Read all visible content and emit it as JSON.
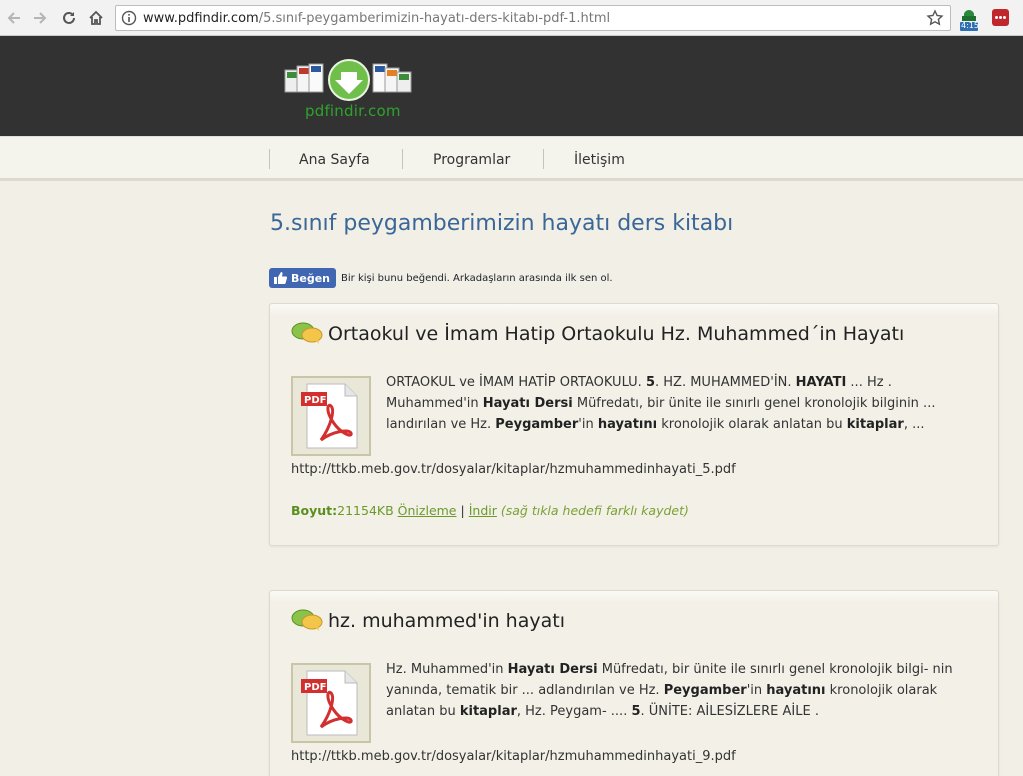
{
  "browser": {
    "url_host": "www.pdfindir.com",
    "url_path": "/5.sınıf-peygamberimizin-hayatı-ders-kitabı-pdf-1.html",
    "ext_badge": "4:15"
  },
  "site": {
    "logo_text": "pdfindir.com"
  },
  "nav": {
    "items": [
      "Ana Sayfa",
      "Programlar",
      "İletişim"
    ]
  },
  "page": {
    "title": "5.sınıf peygamberimizin hayatı ders kitabı"
  },
  "facebook": {
    "button": "Beğen",
    "text": "Bir kişi bunu beğendi. Arkadaşların arasında ilk sen ol."
  },
  "results": [
    {
      "title": "Ortaokul ve İmam Hatip Ortaokulu Hz. Muhammed´in Hayatı",
      "url": "http://ttkb.meb.gov.tr/dosyalar/kitaplar/hzmuhammedinhayati_5.pdf",
      "size_label": "Boyut:",
      "size_value": "21154KB",
      "preview_label": "Önizleme",
      "separator": "|",
      "download_label": "İndir",
      "hint": "(sağ tıkla hedefi farklı kaydet)"
    },
    {
      "title": "hz. muhammed'in hayatı",
      "url": "http://ttkb.meb.gov.tr/dosyalar/kitaplar/hzmuhammedinhayati_9.pdf"
    }
  ],
  "snippets": {
    "r0": [
      {
        "t": "ORTAOKUL ve İMAM HATİP ORTAOKULU. "
      },
      {
        "t": "5",
        "b": true
      },
      {
        "t": ". HZ. MUHAMMED'İN. "
      },
      {
        "t": "HAYATI",
        "b": true
      },
      {
        "t": " ... Hz . Muhammed'in "
      },
      {
        "t": "Hayatı Dersi",
        "b": true
      },
      {
        "t": " Müfredatı, bir ünite ile sınırlı genel kronolojik bilginin ... landırılan ve Hz. "
      },
      {
        "t": "Peygamber",
        "b": true
      },
      {
        "t": "'in "
      },
      {
        "t": "hayatını",
        "b": true
      },
      {
        "t": " kronolojik olarak anlatan bu "
      },
      {
        "t": "kitaplar",
        "b": true
      },
      {
        "t": ", ..."
      }
    ],
    "r1": [
      {
        "t": "Hz. Muhammed'in "
      },
      {
        "t": "Hayatı Dersi",
        "b": true
      },
      {
        "t": " Müfredatı, bir ünite ile sınırlı genel kronolojik bilgi- nin yanında, tematik bir ... adlandırılan ve Hz. "
      },
      {
        "t": "Peygamber",
        "b": true
      },
      {
        "t": "'in "
      },
      {
        "t": "hayatını",
        "b": true
      },
      {
        "t": " kronolojik olarak anlatan bu "
      },
      {
        "t": "kitaplar",
        "b": true
      },
      {
        "t": ", Hz. Peygam- .... "
      },
      {
        "t": "5",
        "b": true
      },
      {
        "t": ". ÜNİTE: AİLESİZLERE AİLE ."
      }
    ]
  }
}
